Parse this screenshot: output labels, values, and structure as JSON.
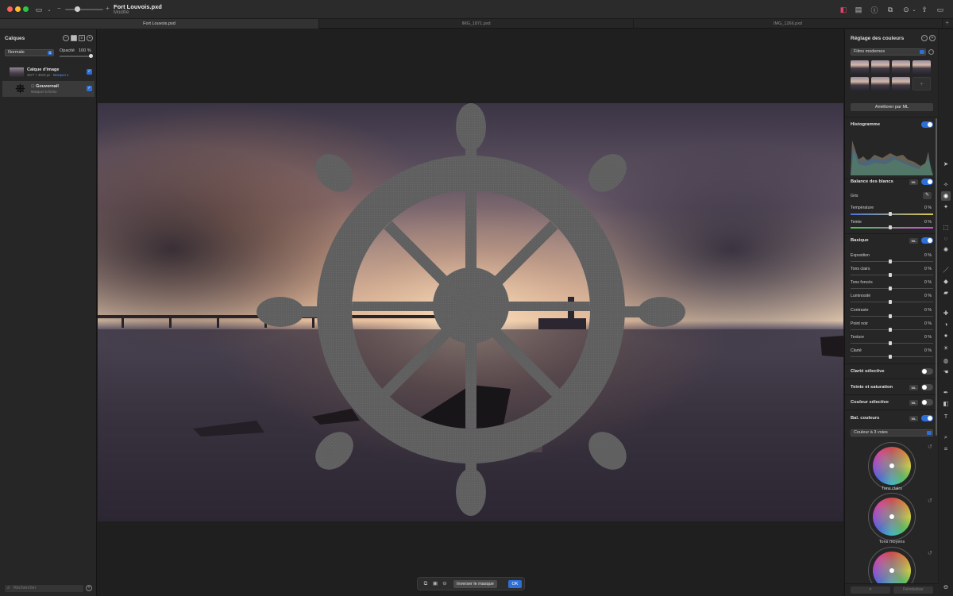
{
  "window": {
    "title": "Fort Louvois.pxd",
    "subtitle": "Modifié"
  },
  "tabs": [
    {
      "label": "Fort Louvois.pxd",
      "active": true
    },
    {
      "label": "IMG_1871.pxd",
      "active": false
    },
    {
      "label": "IMG_1266.pxd",
      "active": false
    }
  ],
  "layers_panel": {
    "title": "Calques",
    "blend_mode": "Normale",
    "opacity_label": "Opacité",
    "opacity_value": "100 %",
    "opacity_fraction": 1.0,
    "layers": [
      {
        "name": "Calque d'image",
        "meta": "4677 × 3019 px · ",
        "meta_link": "Masquer ▾",
        "checked": true
      },
      {
        "name": "Gouvernail",
        "meta": "Masquer la forme",
        "checked": true
      }
    ],
    "search_placeholder": "Rechercher"
  },
  "mask_bar": {
    "invert_label": "Inverser le masque",
    "ok_label": "OK"
  },
  "adjust_panel": {
    "title": "Réglage des couleurs",
    "preset": "Films modernes",
    "ml_button": "Améliorer par ML",
    "histogram_label": "Histogramme",
    "histogram_on": true,
    "white_balance": {
      "label": "Balance des blancs",
      "ml": "ML",
      "on": true,
      "gris_label": "Gris",
      "sliders": [
        {
          "label": "Température",
          "value": "0 %"
        },
        {
          "label": "Teinte",
          "value": "0 %"
        }
      ]
    },
    "basic": {
      "label": "Basique",
      "ml": "ML",
      "on": true,
      "sliders": [
        {
          "label": "Exposition",
          "value": "0 %"
        },
        {
          "label": "Tons clairs",
          "value": "0 %"
        },
        {
          "label": "Tons foncés",
          "value": "0 %"
        },
        {
          "label": "Luminosité",
          "value": "0 %"
        },
        {
          "label": "Contraste",
          "value": "0 %"
        },
        {
          "label": "Point noir",
          "value": "0 %"
        },
        {
          "label": "Texture",
          "value": "0 %"
        },
        {
          "label": "Clarté",
          "value": "0 %"
        }
      ]
    },
    "sections": [
      {
        "label": "Clarté sélective",
        "ml": "",
        "on": false
      },
      {
        "label": "Teinte et saturation",
        "ml": "ML",
        "on": false
      },
      {
        "label": "Couleur sélective",
        "ml": "ML",
        "on": false
      },
      {
        "label": "Bal. couleurs",
        "ml": "ML",
        "on": true
      }
    ],
    "color_balance_mode": "Couleur à 3 voies",
    "wheels": [
      {
        "label": "Tons clairs"
      },
      {
        "label": "Tons moyens"
      },
      {
        "label": ""
      }
    ],
    "footer_reset": "Réinitialiser"
  },
  "colors": {
    "accent": "#2d6fd6",
    "panel": "#262626",
    "mask_overlay": "#5f5f60"
  }
}
